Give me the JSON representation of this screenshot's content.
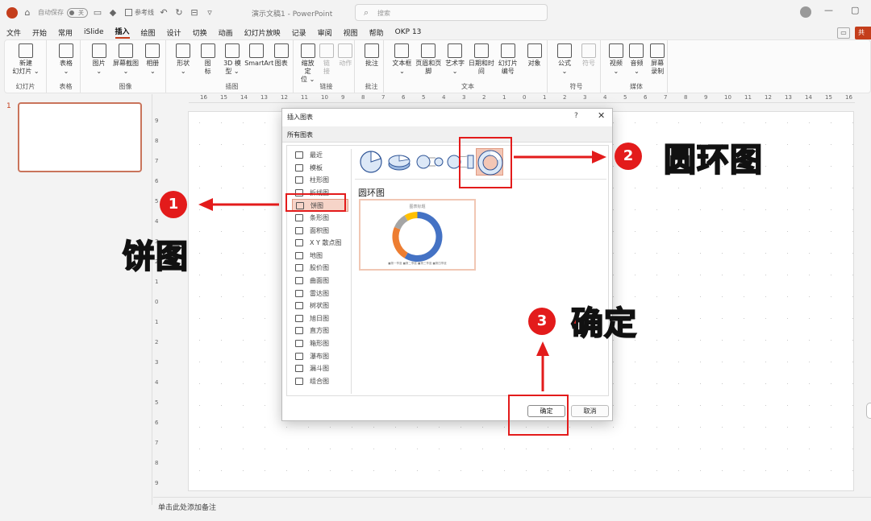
{
  "titlebar": {
    "autosave_label": "自动保存",
    "autosave_state": "关",
    "checkbox_label": "参考线",
    "doc_title": "演示文稿1 - PowerPoint",
    "search_placeholder": "搜索"
  },
  "menu": [
    "文件",
    "开始",
    "常用",
    "iSlide",
    "插入",
    "绘图",
    "设计",
    "切换",
    "动画",
    "幻灯片放映",
    "记录",
    "审阅",
    "视图",
    "帮助",
    "OKP 13"
  ],
  "menu_active": "插入",
  "share_label": "共",
  "ribbon": {
    "groups": [
      {
        "label": "幻灯片",
        "buttons": [
          "新建\n幻灯片 ⌄"
        ]
      },
      {
        "label": "表格",
        "buttons": [
          "表格\n⌄"
        ]
      },
      {
        "label": "图像",
        "buttons": [
          "图片\n⌄",
          "屏幕截图\n⌄",
          "相册\n⌄"
        ]
      },
      {
        "label": "插图",
        "buttons": [
          "形状\n⌄",
          "图\n标",
          "3D 模\n型 ⌄",
          "SmartArt",
          "图表"
        ]
      },
      {
        "label": "链接",
        "buttons": [
          "缩放定\n位 ⌄",
          "链\n接",
          "动作"
        ]
      },
      {
        "label": "批注",
        "buttons": [
          "批注"
        ]
      },
      {
        "label": "文本",
        "buttons": [
          "文本框\n⌄",
          "页眉和页脚",
          "艺术字\n⌄",
          "日期和时间",
          "幻灯片\n编号",
          "对象"
        ]
      },
      {
        "label": "符号",
        "buttons": [
          "公式\n⌄",
          "符号"
        ]
      },
      {
        "label": "媒体",
        "buttons": [
          "视频\n⌄",
          "音频\n⌄",
          "屏幕\n录制"
        ]
      }
    ]
  },
  "ruler_h": [
    "16",
    "15",
    "14",
    "13",
    "12",
    "11",
    "10",
    "9",
    "8",
    "7",
    "6",
    "5",
    "4",
    "3",
    "2",
    "1",
    "0",
    "1",
    "2",
    "3",
    "4",
    "5",
    "6",
    "7",
    "8",
    "9",
    "10",
    "11",
    "12",
    "13",
    "14",
    "15",
    "16"
  ],
  "ruler_v": [
    "9",
    "8",
    "7",
    "6",
    "5",
    "4",
    "3",
    "2",
    "1",
    "0",
    "1",
    "2",
    "3",
    "4",
    "5",
    "6",
    "7",
    "8",
    "9"
  ],
  "slide_panel": {
    "slide_number": "1"
  },
  "notes_placeholder": "单击此处添加备注",
  "dialog": {
    "title": "插入图表",
    "help": "?",
    "close": "✕",
    "tab": "所有图表",
    "categories": [
      "最近",
      "模板",
      "柱形图",
      "折线图",
      "饼图",
      "条形图",
      "面积图",
      "X Y 散点图",
      "地图",
      "股价图",
      "曲面图",
      "雷达图",
      "树状图",
      "旭日图",
      "直方图",
      "箱形图",
      "瀑布图",
      "漏斗图",
      "组合图"
    ],
    "selected_category": "饼图",
    "chart_name": "圆环图",
    "preview_title": "图表标题",
    "preview_legend": "■第一季度  ■第二季度  ■第三季度  ■第四季度",
    "ok_label": "确定",
    "cancel_label": "取消"
  },
  "annotations": {
    "step1_num": "1",
    "step1_text": "饼图",
    "step2_num": "2",
    "step2_text": "圆环图",
    "step3_num": "3",
    "step3_text": "确定"
  },
  "colors": {
    "accent": "#c43e1c",
    "annotation_red": "#e31b1b",
    "donut": [
      "#4472c4",
      "#ed7d31",
      "#a5a5a5",
      "#ffc000"
    ]
  },
  "chart_data": {
    "type": "pie",
    "categories": [
      "第一季度",
      "第二季度",
      "第三季度",
      "第四季度"
    ],
    "values": [
      8.2,
      3.2,
      1.4,
      1.2
    ],
    "title": "图表标题"
  }
}
